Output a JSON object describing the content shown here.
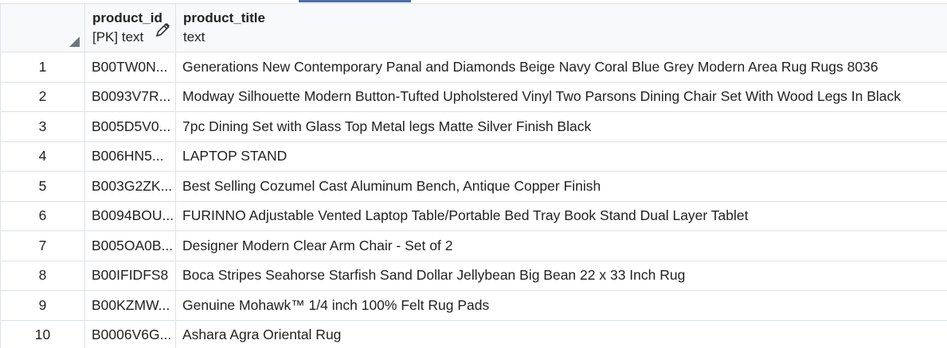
{
  "grid": {
    "columns": [
      {
        "name": "product_id",
        "type": "[PK] text"
      },
      {
        "name": "product_title",
        "type": "text"
      }
    ],
    "rows": [
      {
        "index": "1",
        "product_id": "B00TW0N...",
        "product_title": "Generations New Contemporary Panal and Diamonds Beige Navy Coral Blue Grey Modern Area Rug Rugs 8036"
      },
      {
        "index": "2",
        "product_id": "B0093V7R...",
        "product_title": "Modway Silhouette Modern Button-Tufted Upholstered Vinyl Two Parsons Dining Chair Set With Wood Legs In Black"
      },
      {
        "index": "3",
        "product_id": "B005D5V0...",
        "product_title": "7pc Dining Set with Glass Top Metal legs Matte Silver Finish Black"
      },
      {
        "index": "4",
        "product_id": "B006HN5...",
        "product_title": "LAPTOP STAND"
      },
      {
        "index": "5",
        "product_id": "B003G2ZK...",
        "product_title": "Best Selling Cozumel Cast Aluminum Bench, Antique Copper Finish"
      },
      {
        "index": "6",
        "product_id": "B0094BOU...",
        "product_title": "FURINNO Adjustable Vented Laptop Table/Portable Bed Tray Book Stand Dual Layer Tablet"
      },
      {
        "index": "7",
        "product_id": "B005OA0B...",
        "product_title": "Designer Modern Clear Arm Chair - Set of 2"
      },
      {
        "index": "8",
        "product_id": "B00IFIDFS8",
        "product_title": "Boca Stripes Seahorse Starfish Sand Dollar Jellybean Big Bean 22 x 33 Inch Rug"
      },
      {
        "index": "9",
        "product_id": "B00KZMW...",
        "product_title": "Genuine Mohawk™ 1/4 inch 100% Felt Rug Pads"
      },
      {
        "index": "10",
        "product_id": "B0006V6G...",
        "product_title": "Ashara Agra Oriental Rug"
      }
    ]
  },
  "icons": {
    "corner": "select-all-triangle-icon",
    "edit": "pencil-icon"
  },
  "colors": {
    "header_bg": "#f8f9fa",
    "grid_line": "#dee2e6",
    "accent": "#4a6fa5"
  }
}
